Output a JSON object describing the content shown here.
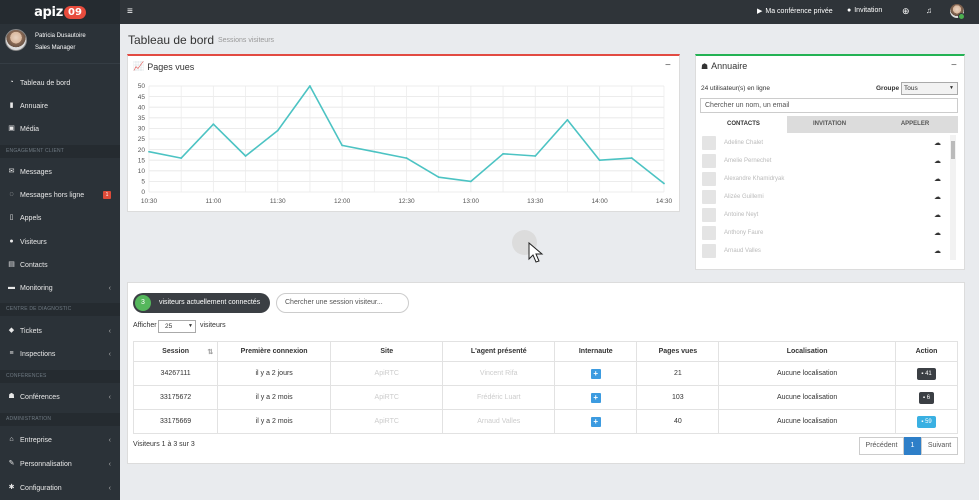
{
  "brand": {
    "logo_a": "apiz",
    "logo_b": "09",
    "accent": "#e84c3d"
  },
  "user": {
    "name": "Patricia Dusautoire",
    "role": "Sales Manager"
  },
  "sidebar": {
    "items": [
      {
        "label": "Tableau de bord",
        "icon": "dashboard-icon"
      },
      {
        "label": "Annuaire",
        "icon": "book-icon"
      },
      {
        "label": "Média",
        "icon": "image-icon"
      }
    ],
    "section_engagement": "ENGAGEMENT CLIENT",
    "engagement": [
      {
        "label": "Messages",
        "icon": "envelope-icon"
      },
      {
        "label": "Messages hors ligne",
        "icon": "chat-icon",
        "badge": "1"
      },
      {
        "label": "Appels",
        "icon": "phone-icon"
      },
      {
        "label": "Visiteurs",
        "icon": "user-icon"
      },
      {
        "label": "Contacts",
        "icon": "contact-card-icon"
      },
      {
        "label": "Monitoring",
        "icon": "monitoring-icon"
      }
    ],
    "section_diag": "CENTRE DE DIAGNOSTIC",
    "diag": [
      {
        "label": "Tickets",
        "icon": "ticket-icon"
      },
      {
        "label": "Inspections",
        "icon": "list-icon"
      }
    ],
    "section_conf": "CONFÉRENCES",
    "conf": [
      {
        "label": "Conférences",
        "icon": "users-icon"
      }
    ],
    "section_admin": "ADMINISTRATION",
    "admin": [
      {
        "label": "Entreprise",
        "icon": "bank-icon"
      },
      {
        "label": "Personnalisation",
        "icon": "brush-icon"
      },
      {
        "label": "Configuration",
        "icon": "cog-icon"
      }
    ]
  },
  "topbar": {
    "conf_label": "Ma conférence privée",
    "invite_label": "Invitation"
  },
  "page": {
    "title": "Tableau de bord",
    "subtitle": "Sessions visiteurs"
  },
  "chart_card": {
    "title": "Pages vues"
  },
  "chart_data": {
    "type": "line",
    "title": "Pages vues",
    "x": [
      "10:30",
      "10:45",
      "11:00",
      "11:15",
      "11:30",
      "11:45",
      "12:00",
      "12:15",
      "12:30",
      "12:45",
      "13:00",
      "13:15",
      "13:30",
      "13:45",
      "14:00",
      "14:15",
      "14:30"
    ],
    "x_ticks": [
      "10:30",
      "11:00",
      "11:30",
      "12:00",
      "12:30",
      "13:00",
      "13:30",
      "14:00",
      "14:30"
    ],
    "series": [
      {
        "values": [
          19,
          16,
          32,
          17,
          29,
          50,
          22,
          19,
          16,
          7,
          5,
          18,
          17,
          34,
          15,
          16,
          4
        ]
      }
    ],
    "ylim": [
      0,
      50
    ],
    "y_ticks": [
      0,
      5,
      10,
      15,
      20,
      25,
      30,
      35,
      40,
      45,
      50
    ],
    "grid": true,
    "color": "#4cc3c3"
  },
  "directory": {
    "title": "Annuaire",
    "online": "24 utilisateur(s) en ligne",
    "group_label": "Groupe",
    "group_value": "Tous",
    "search_placeholder": "Chercher un nom, un email",
    "tabs": [
      "CONTACTS",
      "INVITATION",
      "APPELER"
    ],
    "contacts": [
      "Adeline Chalet",
      "Amelie Pernechet",
      "Alexandre Khamidryak",
      "Alizée Guillemi",
      "Antoine Neyt",
      "Anthony Faure",
      "Arnaud Valles"
    ]
  },
  "sessions": {
    "connected_count": "3",
    "connected_label": "visiteurs actuellement connectés",
    "search_placeholder": "Chercher une session visiteur...",
    "show_label": "Afficher",
    "per_page": "25",
    "visitors_label": "visiteurs",
    "columns": [
      "Session",
      "Première connexion",
      "Site",
      "L'agent présenté",
      "Internaute",
      "Pages vues",
      "Localisation",
      "Action"
    ],
    "rows": [
      {
        "session": "34267111",
        "first": "il y a 2 jours",
        "site": "ApiRTC",
        "agent": "Vincent Rifa",
        "pages": "21",
        "loc": "Aucune localisation",
        "action": "41",
        "action_color": "#3b3f44"
      },
      {
        "session": "33175672",
        "first": "il y a 2 mois",
        "site": "ApiRTC",
        "agent": "Frédéric Luart",
        "pages": "103",
        "loc": "Aucune localisation",
        "action": "6",
        "action_color": "#3b3f44"
      },
      {
        "session": "33175669",
        "first": "il y a 2 mois",
        "site": "ApiRTC",
        "agent": "Arnaud Valles",
        "pages": "40",
        "loc": "Aucune localisation",
        "action": "59",
        "action_color": "#3ab0e2"
      }
    ],
    "info": "Visiteurs 1 à 3 sur 3",
    "prev": "Précédent",
    "page": "1",
    "next": "Suivant"
  }
}
